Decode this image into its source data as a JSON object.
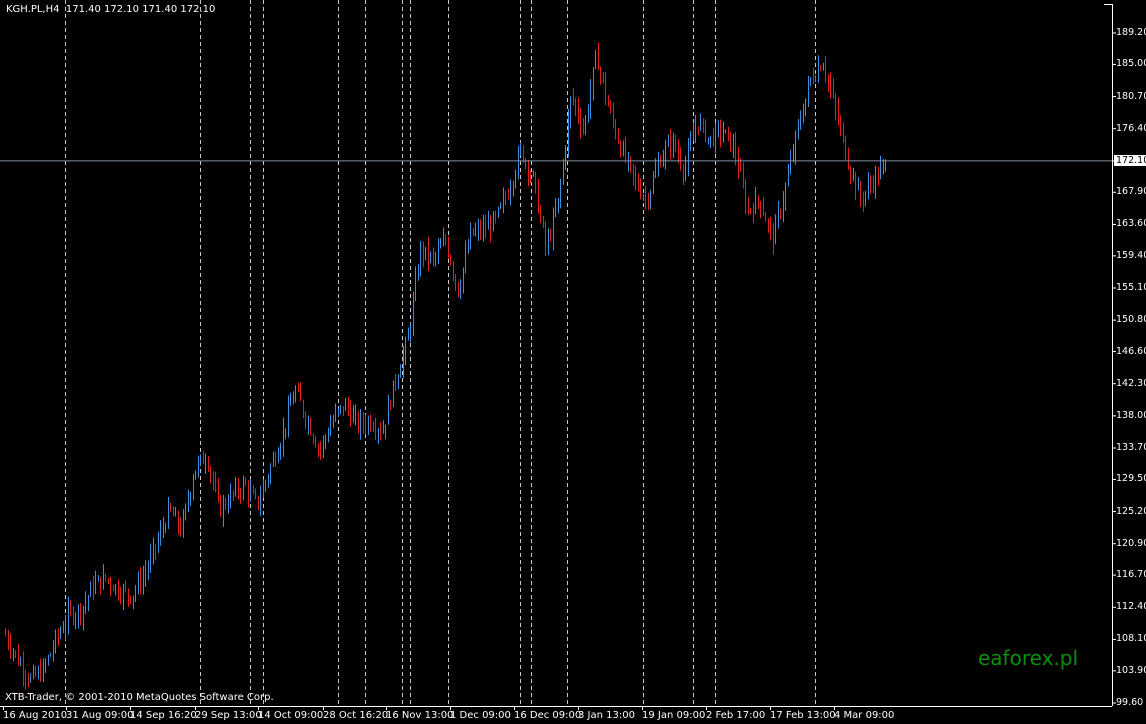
{
  "header": {
    "symbol": "KGH.PL,H4",
    "ohlc": "171.40 172.10 171.40 172.10"
  },
  "copyright": "XTB-Trader, © 2001-2010 MetaQuotes Software Corp.",
  "watermark": "eaforex.pl",
  "colors": {
    "background": "#000000",
    "up_bar": "#3a8fe0",
    "down_bar": "#e0201a",
    "grid_separator": "#c8c8c8",
    "current_price_line": "#8090a8",
    "watermark": "#0a8f0a"
  },
  "chart_data": {
    "type": "ohlc-bar",
    "symbol": "KGH.PL",
    "timeframe": "H4",
    "ylim": [
      99.6,
      191.0
    ],
    "current_price": 172.1,
    "y_ticks": [
      "189.20",
      "185.00",
      "180.70",
      "176.40",
      "172.10",
      "167.90",
      "163.60",
      "159.40",
      "155.10",
      "150.80",
      "146.60",
      "142.30",
      "138.00",
      "133.70",
      "129.50",
      "125.20",
      "120.90",
      "116.70",
      "112.40",
      "108.10",
      "103.90",
      "99.60"
    ],
    "x_ticks": [
      "16 Aug 2010",
      "31 Aug 09:00",
      "14 Sep 16:20",
      "29 Sep 13:00",
      "14 Oct 09:00",
      "28 Oct 16:20",
      "16 Nov 13:00",
      "1 Dec 09:00",
      "16 Dec 09:00",
      "3 Jan 13:00",
      "19 Jan 09:00",
      "2 Feb 17:00",
      "17 Feb 13:00",
      "4 Mar 09:00"
    ],
    "approx_close_path": [
      108.7,
      105.4,
      102.7,
      104.0,
      108.0,
      111.4,
      112.0,
      115.4,
      116.3,
      114.7,
      114.0,
      116.7,
      120.7,
      125.4,
      122.7,
      130.8,
      132.8,
      125.4,
      127.4,
      128.8,
      126.1,
      130.8,
      135.4,
      141.5,
      137.4,
      133.4,
      137.4,
      139.5,
      136.8,
      137.4,
      136.1,
      142.8,
      148.1,
      160.2,
      158.8,
      161.5,
      154.8,
      162.2,
      162.9,
      164.2,
      168.2,
      173.6,
      169.5,
      160.2,
      166.9,
      180.9,
      176.2,
      186.3,
      178.9,
      173.6,
      169.5,
      166.9,
      172.2,
      174.9,
      170.9,
      177.6,
      174.9,
      176.2,
      173.6,
      165.5,
      166.9,
      161.5,
      168.2,
      176.2,
      182.9,
      185.6,
      178.9,
      172.2,
      166.9,
      169.5,
      171.5
    ]
  }
}
